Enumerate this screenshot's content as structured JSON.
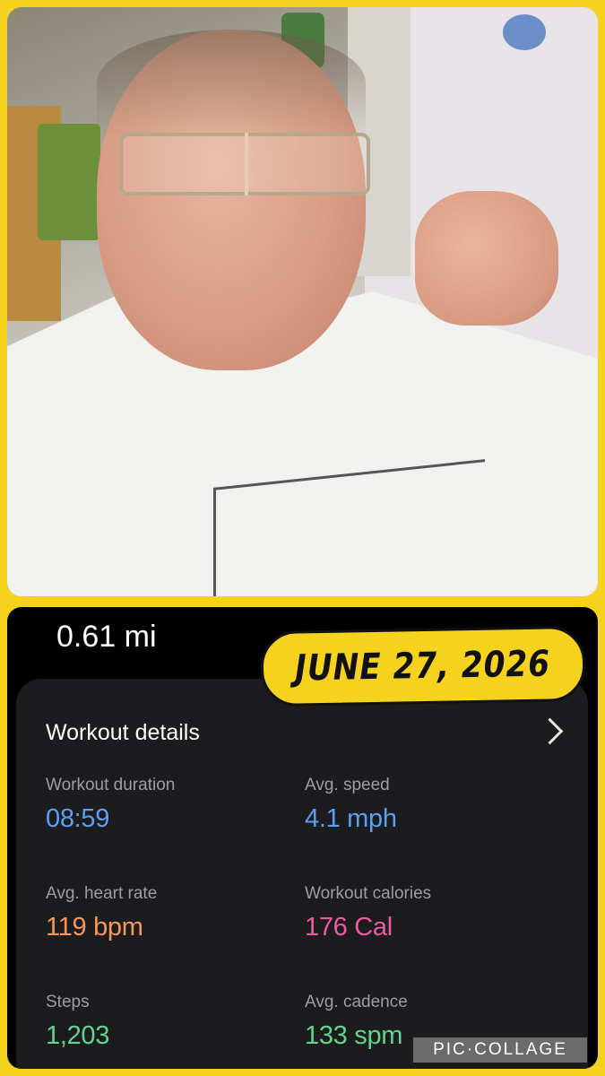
{
  "photo": {
    "description_icon": "selfie-photo"
  },
  "workout": {
    "distance": "0.61 mi",
    "details_title": "Workout details",
    "metrics": [
      {
        "label": "Workout duration",
        "value": "08:59",
        "color": "#5aa0f2"
      },
      {
        "label": "Avg. speed",
        "value": "4.1 mph",
        "color": "#5aa0f2"
      },
      {
        "label": "Avg. heart rate",
        "value": "119 bpm",
        "color": "#f2995a"
      },
      {
        "label": "Workout calories",
        "value": "176 Cal",
        "color": "#ef5aa3"
      },
      {
        "label": "Steps",
        "value": "1,203",
        "color": "#5fd58d"
      },
      {
        "label": "Avg. cadence",
        "value": "133 spm",
        "color": "#5fd58d"
      }
    ]
  },
  "date_badge": "JUNE 27, 2026",
  "watermark": "PIC·COLLAGE",
  "colors": {
    "frame": "#f5d21e",
    "app_bg": "#000000",
    "card_bg": "#1c1c1e"
  }
}
